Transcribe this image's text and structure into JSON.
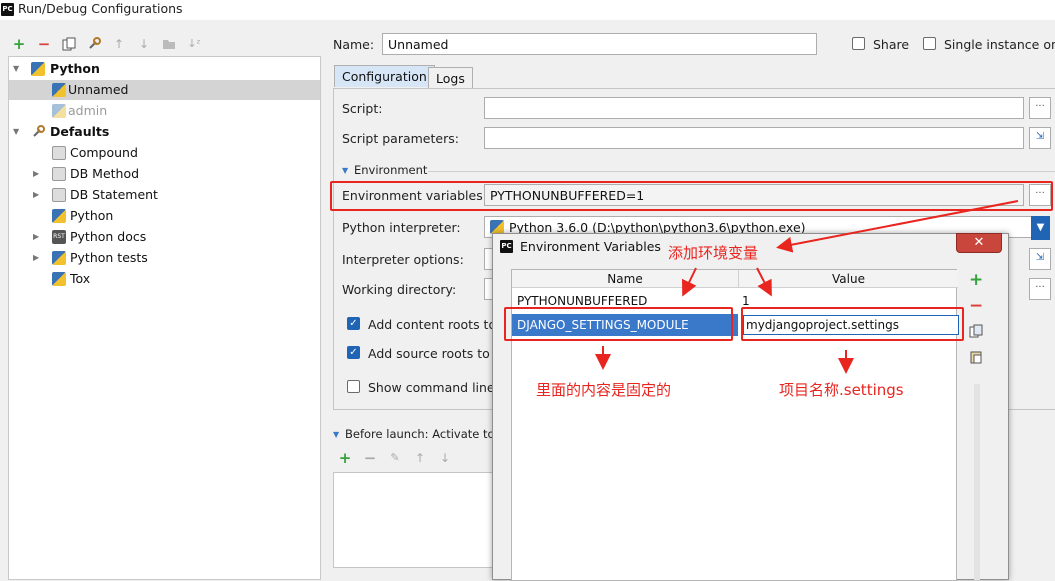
{
  "window": {
    "title": "Run/Debug Configurations",
    "logo_text": "PC"
  },
  "toolbar_icons": [
    "add-icon",
    "remove-icon",
    "copy-icon",
    "wrench-icon",
    "arrow-up-icon",
    "arrow-down-icon",
    "folder-icon",
    "sort-icon"
  ],
  "tree": {
    "python": "Python",
    "unnamed": "Unnamed",
    "admin": "admin",
    "defaults": "Defaults",
    "compound": "Compound",
    "db_method": "DB Method",
    "db_statement": "DB Statement",
    "python_default": "Python",
    "python_docs": "Python docs",
    "python_tests": "Python tests",
    "tox": "Tox"
  },
  "header": {
    "name_label": "Name:",
    "name_value": "Unnamed",
    "share_label": "Share",
    "single_instance_label": "Single instance only"
  },
  "tabs": {
    "configuration": "Configuration",
    "logs": "Logs"
  },
  "form": {
    "script_label": "Script:",
    "script_value": "",
    "script_params_label": "Script parameters:",
    "env_section": "Environment",
    "env_vars_label": "Environment variables:",
    "env_vars_value": "PYTHONUNBUFFERED=1",
    "interpreter_label": "Python interpreter:",
    "interpreter_value": "Python 3.6.0 (D:\\python\\python3.6\\python.exe)",
    "interp_options_label": "Interpreter options:",
    "working_dir_label": "Working directory:",
    "add_content_roots": "Add content roots to",
    "add_source_roots": "Add source roots to",
    "show_command_line": "Show command line a",
    "before_launch": "Before launch: Activate tool"
  },
  "dialog": {
    "title": "Environment Variables",
    "col_name": "Name",
    "col_value": "Value",
    "rows": [
      {
        "name": "PYTHONUNBUFFERED",
        "value": "1"
      },
      {
        "name": "DJANGO_SETTINGS_MODULE",
        "value": "mydjangoproject.settings"
      }
    ]
  },
  "annotations": {
    "add_env": "添加环境变量",
    "fixed_content": "里面的内容是固定的",
    "project_settings": "项目名称.settings"
  },
  "colors": {
    "accent": "#1f64b5",
    "selection": "#3a78c9",
    "annotation": "#e8251f"
  }
}
